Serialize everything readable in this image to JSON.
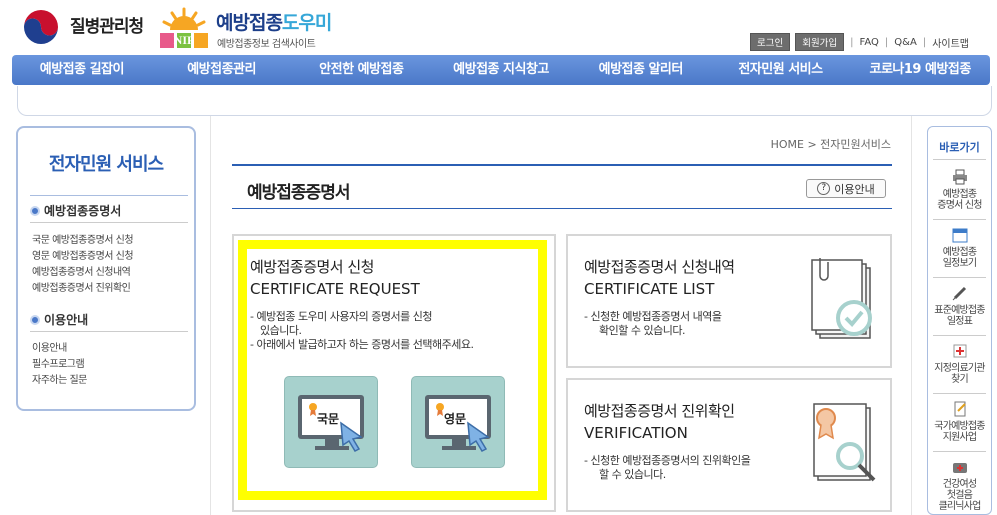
{
  "header": {
    "agency_name": "질병관리청",
    "site_title_main": "예방접종",
    "site_title_accent": "도우미",
    "site_subtitle": "예방접종정보 검색사이트",
    "nip_logo_text": "NIP",
    "util_links": {
      "login": "로그인",
      "join": "회원가입",
      "faq": "FAQ",
      "qa": "Q&A",
      "sitemap": "사이트맵",
      "sep": "|"
    }
  },
  "gnb": [
    "예방접종 길잡이",
    "예방접종관리",
    "안전한 예방접종",
    "예방접종 지식창고",
    "예방접종 알리터",
    "전자민원 서비스",
    "코로나19 예방접종"
  ],
  "lnb": {
    "title": "전자민원 서비스",
    "section1": "예방접종증명서",
    "links1": [
      "국문 예방접종증명서 신청",
      "영문 예방접종증명서 신청",
      "예방접종증명서 신청내역",
      "예방접종증명서 진위확인"
    ],
    "section2": "이용안내",
    "links2": [
      "이용안내",
      "필수프로그램",
      "자주하는 질문"
    ]
  },
  "breadcrumb": "HOME > 전자민원서비스",
  "page_title": "예방접종증명서",
  "help_button": "이용안내",
  "help_icon_glyph": "?",
  "cards": {
    "request": {
      "title_ko": "예방접종증명서 신청",
      "title_en": "CERTIFICATE REQUEST",
      "desc1": "- 예방접종 도우미 사용자의 증명서를 신청",
      "desc1b": "있습니다.",
      "desc2": "- 아래에서 발급하고자 하는 증명서를 선택해주세요.",
      "btn_korean": "국문",
      "btn_english": "영문"
    },
    "list": {
      "title_ko": "예방접종증명서 신청내역",
      "title_en": "CERTIFICATE LIST",
      "desc1": "- 신청한 예방접종증명서 내역을",
      "desc1b": "확인할 수 있습니다."
    },
    "verify": {
      "title_ko": "예방접종증명서 진위확인",
      "title_en": "VERIFICATION",
      "desc1": "- 신청한 예방접종증명서의 진위확인을",
      "desc1b": "할 수 있습니다."
    }
  },
  "quick": {
    "title": "바로가기",
    "items": [
      {
        "l1": "예방접종",
        "l2": "증명서 신청",
        "icon": "printer-icon"
      },
      {
        "l1": "예방접종",
        "l2": "일정보기",
        "icon": "calendar-icon"
      },
      {
        "l1": "표준예방접종",
        "l2": "일정표",
        "icon": "syringe-icon"
      },
      {
        "l1": "지정의료기관",
        "l2": "찾기",
        "icon": "hospital-icon"
      },
      {
        "l1": "국가예방접종",
        "l2": "지원사업",
        "icon": "document-icon"
      },
      {
        "l1": "건강여성",
        "l2": "첫걸음",
        "l3": "클리닉사업",
        "icon": "first-aid-icon"
      }
    ]
  },
  "colors": {
    "brand_blue": "#2b5fb4",
    "nav_blue": "#4a78c8",
    "highlight": "#ffff00",
    "button_teal": "#a7d1cd"
  }
}
